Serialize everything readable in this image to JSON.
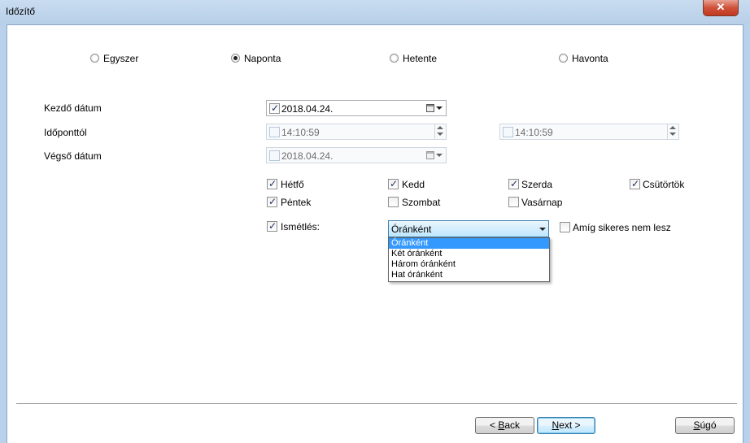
{
  "window": {
    "title": "Időzítő",
    "close_symbol": "✕"
  },
  "frequency": {
    "options": [
      {
        "label": "Egyszer",
        "checked": false
      },
      {
        "label": "Naponta",
        "checked": true
      },
      {
        "label": "Hetente",
        "checked": false
      },
      {
        "label": "Havonta",
        "checked": false
      }
    ]
  },
  "form": {
    "start_date_label": "Kezdő dátum",
    "start_date_value": "2018.04.24.",
    "time_from_label": "Időponttól",
    "time_from_value": "14:10:59",
    "time_to_value": "14:10:59",
    "end_date_label": "Végső dátum",
    "end_date_value": "2018.04.24."
  },
  "days": [
    {
      "label": "Hétfő",
      "checked": true
    },
    {
      "label": "Kedd",
      "checked": true
    },
    {
      "label": "Szerda",
      "checked": true
    },
    {
      "label": "Csütörtök",
      "checked": true
    },
    {
      "label": "Péntek",
      "checked": true
    },
    {
      "label": "Szombat",
      "checked": false
    },
    {
      "label": "Vasárnap",
      "checked": false
    }
  ],
  "repeat": {
    "label": "Ismétlés:",
    "selected": "Óránként",
    "options": [
      "Óránként",
      "Két óránként",
      "Három óránként",
      "Hat óránként"
    ],
    "until_success_label": "Amíg sikeres nem lesz"
  },
  "buttons": {
    "back_prefix": "< ",
    "back_key": "B",
    "back_rest": "ack",
    "next_prefix": "",
    "next_key": "N",
    "next_rest": "ext >",
    "help_key": "S",
    "help_rest": "úgó"
  }
}
